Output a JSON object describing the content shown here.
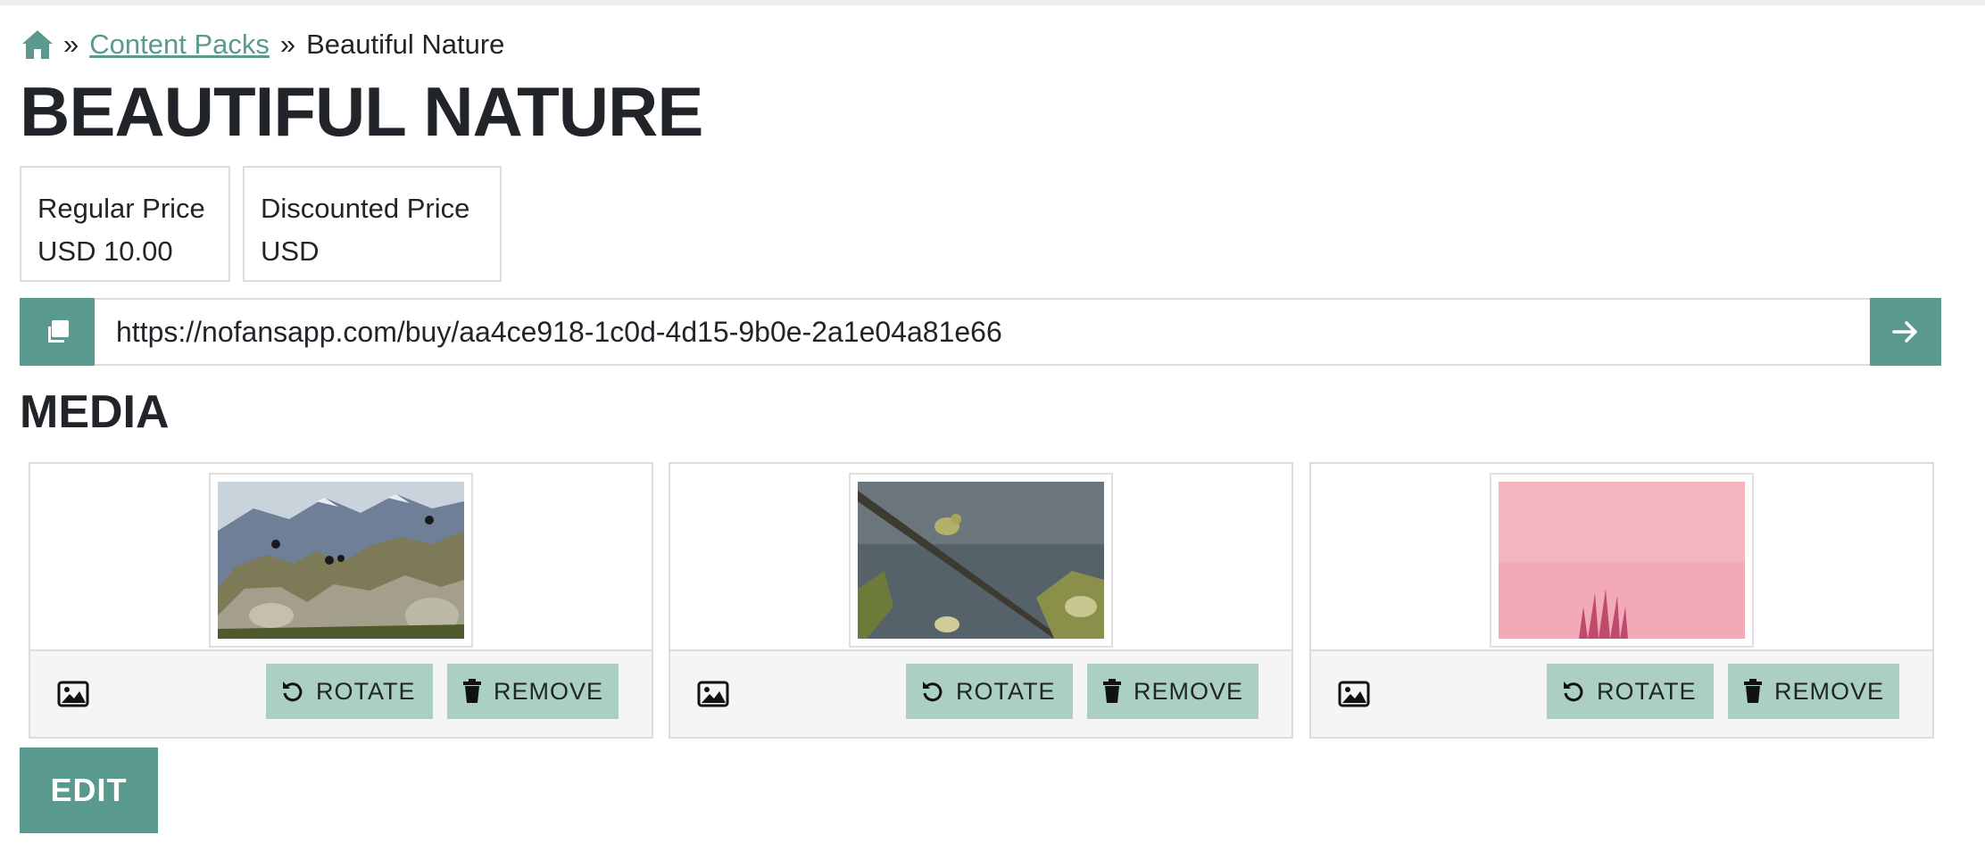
{
  "breadcrumb": {
    "separator": "»",
    "link_label": "Content Packs",
    "current": "Beautiful Nature"
  },
  "page_title": "BEAUTIFUL NATURE",
  "prices": {
    "regular_label": "Regular Price",
    "regular_value": "USD 10.00",
    "discount_label": "Discounted Price",
    "discount_value": "USD"
  },
  "url": "https://nofansapp.com/buy/aa4ce918-1c0d-4d15-9b0e-2a1e04a81e66",
  "media_title": "MEDIA",
  "media": [
    {
      "rotate_label": "ROTATE",
      "remove_label": "REMOVE"
    },
    {
      "rotate_label": "ROTATE",
      "remove_label": "REMOVE"
    },
    {
      "rotate_label": "ROTATE",
      "remove_label": "REMOVE"
    }
  ],
  "edit_label": "EDIT",
  "colors": {
    "accent": "#5a9a8e",
    "button_light": "#abd0c3"
  }
}
